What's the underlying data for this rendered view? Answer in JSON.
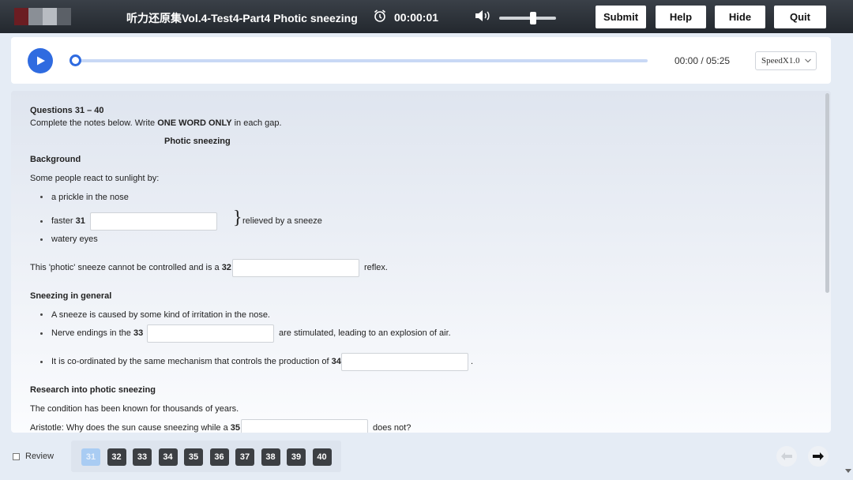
{
  "header": {
    "title": "听力还原集Vol.4-Test4-Part4 Photic sneezing",
    "timer": "00:00:01",
    "volume_level": 0.6,
    "buttons": {
      "submit": "Submit",
      "help": "Help",
      "hide": "Hide",
      "quit": "Quit"
    }
  },
  "player": {
    "time": "00:00 / 05:25",
    "speed": "SpeedX1.0",
    "progress": 0
  },
  "content": {
    "questions_heading": "Questions 31 – 40",
    "instructions_pre": "Complete the notes below. Write ",
    "instructions_bold": "ONE WORD ONLY",
    "instructions_post": " in each gap.",
    "notes_title": "Photic sneezing",
    "background_heading": "Background",
    "background_intro": "Some people react to sunlight by:",
    "bullet_1": "a prickle in the nose",
    "bullet_2_pre": "faster ",
    "q31": "31",
    "bullet_3": "watery eyes",
    "relieved": "relieved by a sneeze",
    "photic_pre": "This 'photic' sneeze cannot be controlled and is a ",
    "q32": "32",
    "photic_post": "reflex.",
    "general_heading": "Sneezing in general",
    "general_b1": "A sneeze is caused by some kind of irritation in the nose.",
    "general_b2_pre": "Nerve endings in the ",
    "q33": "33",
    "general_b2_post": "are stimulated, leading to an explosion of air.",
    "general_b3_pre": "It is co-ordinated by the same mechanism that controls the production of ",
    "q34": "34",
    "general_b3_post": ".",
    "research_heading": "Research into photic sneezing",
    "research_line": "The condition has been known for thousands of years.",
    "aristotle_pre": "Aristotle: Why does the sun cause sneezing while a ",
    "q35": "35",
    "aristotle_post": "does not?"
  },
  "footer": {
    "review": "Review",
    "questions": [
      "31",
      "32",
      "33",
      "34",
      "35",
      "36",
      "37",
      "38",
      "39",
      "40"
    ],
    "active_question": "31"
  }
}
